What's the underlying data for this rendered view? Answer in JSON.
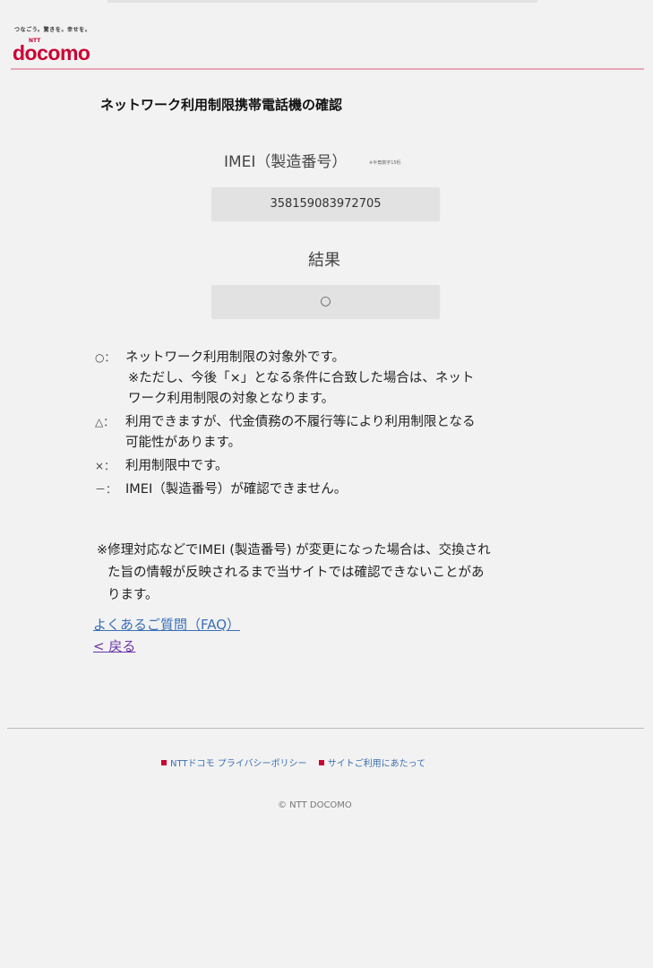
{
  "header": {
    "tagline": "つなごう。驚きを。幸せを。",
    "ntt_mark": "NTT",
    "logo_text": "docomo",
    "brand_color": "#cc0033"
  },
  "page_title": "ネットワーク利用制限携帯電話機の確認",
  "imei": {
    "label": "IMEI（製造番号）",
    "note": "※半角数字15桁",
    "value": "358159083972705"
  },
  "result": {
    "label": "結果",
    "value": "○"
  },
  "legend": [
    {
      "symbol": "○：",
      "lines": [
        "ネットワーク利用制限の対象外です。"
      ],
      "sub_lines": [
        "※ただし、今後「×」となる条件に合致した場合は、ネット",
        "ワーク利用制限の対象となります。"
      ]
    },
    {
      "symbol": "△：",
      "lines": [
        "利用できますが、代金債務の不履行等により利用制限となる",
        "可能性があります。"
      ]
    },
    {
      "symbol": "×：",
      "lines": [
        "利用制限中です。"
      ]
    },
    {
      "symbol": "－：",
      "lines": [
        "IMEI（製造番号）が確認できません。"
      ]
    }
  ],
  "note": {
    "line1": "※修理対応などでIMEI (製造番号) が変更になった場合は、交換され",
    "line2": "た旨の情報が反映されるまで当サイトでは確認できないことがあ",
    "line3": "ります。"
  },
  "links": {
    "faq": "よくあるご質問（FAQ）",
    "back": "< 戻る",
    "link_color": "#3a6fb5"
  },
  "footer": {
    "privacy": "NTTドコモ プライバシーポリシー",
    "terms": "サイトご利用にあたって",
    "copyright": "© NTT DOCOMO"
  }
}
